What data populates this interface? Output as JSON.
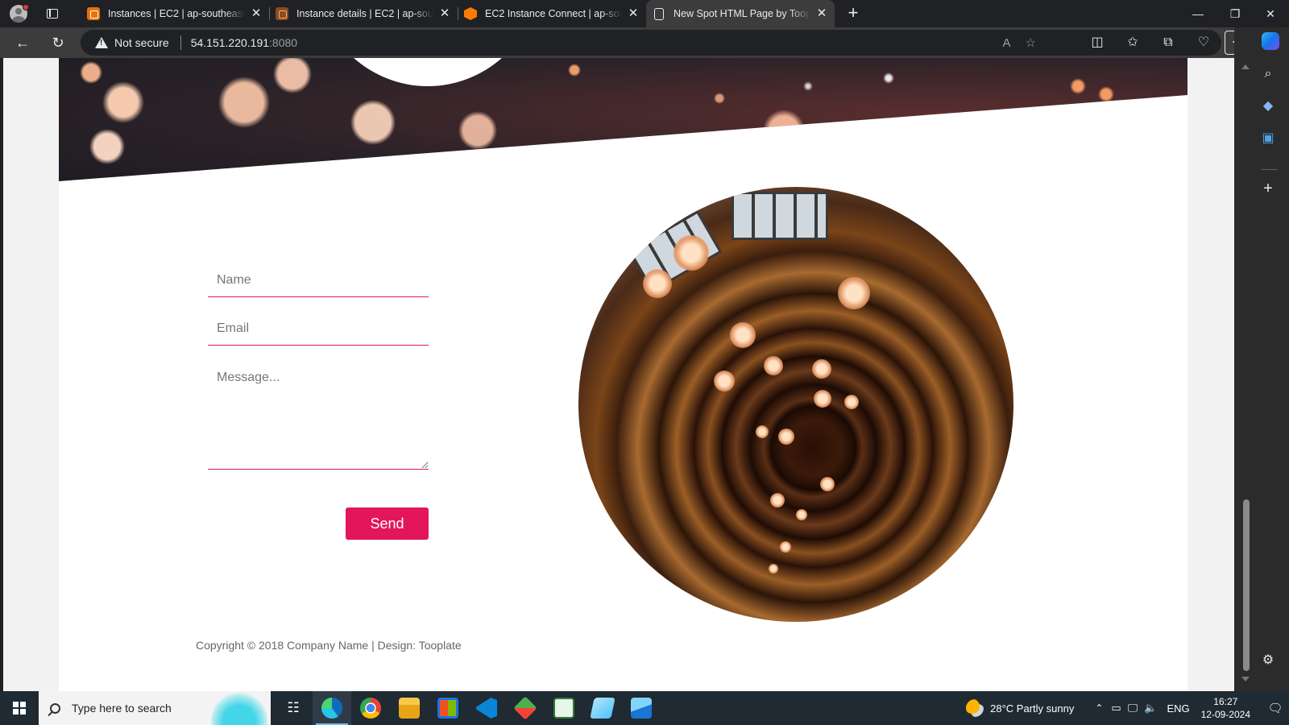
{
  "browser": {
    "tabs": [
      {
        "title": "Instances | EC2 | ap-southeast-1",
        "favicon": "ec2-icon"
      },
      {
        "title": "Instance details | EC2 | ap-southeast-1",
        "favicon": "ec2-icon"
      },
      {
        "title": "EC2 Instance Connect | ap-southeast-1",
        "favicon": "aws-hexagon-icon"
      },
      {
        "title": "New Spot HTML Page by Tooplate",
        "favicon": "page-icon",
        "active": true
      }
    ],
    "security_label": "Not secure",
    "url_host": "54.151.220.191",
    "url_port": ":8080"
  },
  "page": {
    "form": {
      "name_placeholder": "Name",
      "email_placeholder": "Email",
      "message_placeholder": "Message...",
      "send_label": "Send"
    },
    "footer": "Copyright © 2018 Company Name | Design: Tooplate",
    "accent_color": "#e3165b"
  },
  "taskbar": {
    "search_placeholder": "Type here to search",
    "weather": "28°C  Partly sunny",
    "language": "ENG",
    "time": "16:27",
    "date": "12-09-2024"
  }
}
